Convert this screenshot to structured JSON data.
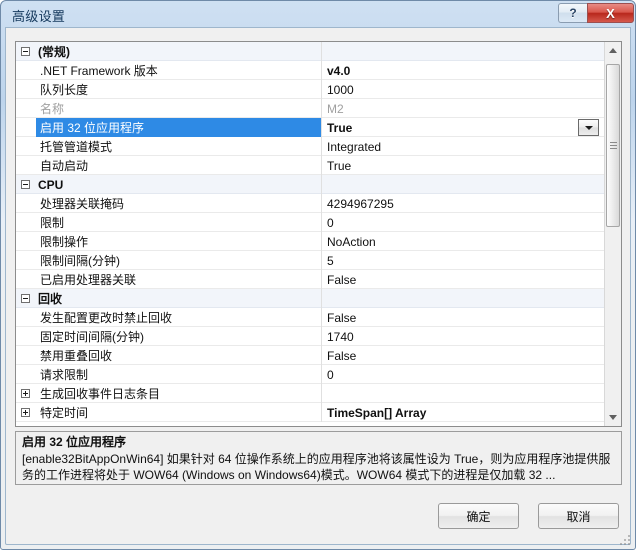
{
  "window": {
    "title": "高级设置",
    "help_label": "?",
    "close_label": "X",
    "accent_selection": "#2e8ae5",
    "close_button_color": "#c0392b"
  },
  "grid": {
    "rows": [
      {
        "kind": "category",
        "expander": "minus",
        "name": "(常规)",
        "value": ""
      },
      {
        "kind": "property",
        "name": ".NET Framework 版本",
        "value": "v4.0",
        "value_bold": true
      },
      {
        "kind": "property",
        "name": "队列长度",
        "value": "1000"
      },
      {
        "kind": "property",
        "name": "名称",
        "value": "M2",
        "dim": true
      },
      {
        "kind": "property",
        "name": "启用 32 位应用程序",
        "value": "True",
        "value_bold": true,
        "selected": true,
        "dropdown": true
      },
      {
        "kind": "property",
        "name": "托管管道模式",
        "value": "Integrated"
      },
      {
        "kind": "property",
        "name": "自动启动",
        "value": "True"
      },
      {
        "kind": "category",
        "expander": "minus",
        "name": "CPU",
        "value": ""
      },
      {
        "kind": "property",
        "name": "处理器关联掩码",
        "value": "4294967295"
      },
      {
        "kind": "property",
        "name": "限制",
        "value": "0"
      },
      {
        "kind": "property",
        "name": "限制操作",
        "value": "NoAction"
      },
      {
        "kind": "property",
        "name": "限制间隔(分钟)",
        "value": "5"
      },
      {
        "kind": "property",
        "name": "已启用处理器关联",
        "value": "False"
      },
      {
        "kind": "category",
        "expander": "minus",
        "name": "回收",
        "value": ""
      },
      {
        "kind": "property",
        "name": "发生配置更改时禁止回收",
        "value": "False"
      },
      {
        "kind": "property",
        "name": "固定时间间隔(分钟)",
        "value": "1740"
      },
      {
        "kind": "property",
        "name": "禁用重叠回收",
        "value": "False"
      },
      {
        "kind": "property",
        "name": "请求限制",
        "value": "0"
      },
      {
        "kind": "expandable",
        "expander": "plus",
        "name": "生成回收事件日志条目",
        "value": ""
      },
      {
        "kind": "expandable",
        "expander": "plus",
        "name": "特定时间",
        "value": "TimeSpan[] Array",
        "value_bold": true
      }
    ]
  },
  "scrollbar": {
    "up_arrow": "▲",
    "down_arrow": "▼"
  },
  "description": {
    "title": "启用 32 位应用程序",
    "body": "[enable32BitAppOnWin64] 如果针对 64 位操作系统上的应用程序池将该属性设为 True，则为应用程序池提供服务的工作进程将处于 WOW64 (Windows on Windows64)模式。WOW64 模式下的进程是仅加载 32 ..."
  },
  "footer": {
    "ok_label": "确定",
    "cancel_label": "取消"
  }
}
